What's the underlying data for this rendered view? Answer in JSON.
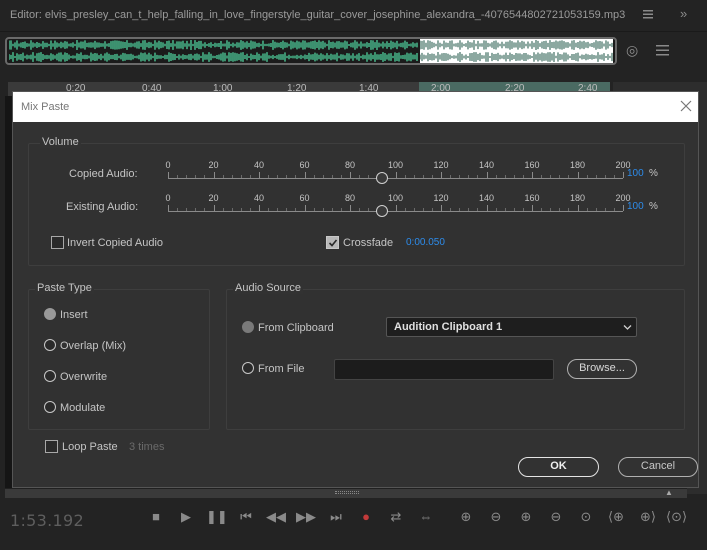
{
  "editor": {
    "title": "Editor: elvis_presley_can_t_help_falling_in_love_fingerstyle_guitar_cover_josephine_alexandra_-4076544802721053159.mp3",
    "ruler_labels": [
      "0:20",
      "0:40",
      "1:00",
      "1:20",
      "1:40",
      "2:00",
      "2:20",
      "2:40"
    ],
    "time_display": "1:53.192"
  },
  "dialog": {
    "title": "Mix Paste",
    "volume": {
      "title": "Volume",
      "scale": [
        "0",
        "20",
        "40",
        "60",
        "80",
        "100",
        "120",
        "140",
        "160",
        "180",
        "200"
      ],
      "copied_label": "Copied Audio:",
      "copied_value": "100",
      "existing_label": "Existing Audio:",
      "existing_value": "100",
      "percent_sign": "%",
      "invert_label": "Invert Copied Audio",
      "invert_checked": false,
      "crossfade_label": "Crossfade",
      "crossfade_checked": true,
      "crossfade_value": "0:00.050"
    },
    "paste_type": {
      "title": "Paste Type",
      "options": [
        "Insert",
        "Overlap (Mix)",
        "Overwrite",
        "Modulate"
      ],
      "selected": "Insert"
    },
    "audio_source": {
      "title": "Audio Source",
      "from_clipboard_label": "From Clipboard",
      "clipboard_selected": "Audition Clipboard 1",
      "from_file_label": "From File",
      "file_path": "",
      "browse_label": "Browse..."
    },
    "loop": {
      "label": "Loop Paste",
      "checked": false,
      "times": "3 times"
    },
    "ok_label": "OK",
    "cancel_label": "Cancel"
  },
  "colors": {
    "accent_value": "#2d8ceb",
    "waveform": "#54e0a8",
    "dialog_bg": "#323232"
  }
}
